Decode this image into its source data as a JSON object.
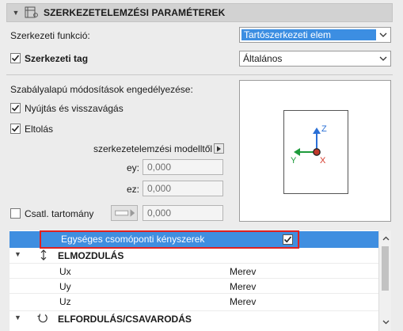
{
  "header": {
    "title": "SZERKEZETELEMZÉSI PARAMÉTEREK"
  },
  "structural_function": {
    "label": "Szerkezeti funkció:",
    "value": "Tartószerkezeti elem"
  },
  "structural_member": {
    "label": "Szerkezeti tag",
    "checked": true,
    "value": "Általános"
  },
  "rule_based": {
    "label": "Szabályalapú módosítások engedélyezése:",
    "extend_trim": {
      "label": "Nyújtás és visszavágás",
      "checked": true
    },
    "offset": {
      "label": "Eltolás",
      "checked": true
    }
  },
  "offset_source": {
    "label": "szerkezetelemzési modelltől"
  },
  "ey": {
    "label": "ey:",
    "value": "0,000"
  },
  "ez": {
    "label": "ez:",
    "value": "0,000"
  },
  "connection_range": {
    "label": "Csatl. tartomány",
    "checked": false,
    "value": "0,000"
  },
  "preview": {
    "axis_z": "Z",
    "axis_y": "Y",
    "axis_x": "X",
    "colors": {
      "z": "#2a6fd6",
      "y": "#1e9b3c",
      "x": "#d63a2a"
    }
  },
  "table": {
    "selected_row": {
      "label": "Egységes csomóponti kényszerek",
      "checked": true
    },
    "group_translation": {
      "label": "ELMOZDULÁS"
    },
    "rows": [
      {
        "name": "Ux",
        "value": "Merev"
      },
      {
        "name": "Uy",
        "value": "Merev"
      },
      {
        "name": "Uz",
        "value": "Merev"
      }
    ],
    "group_rotation": {
      "label": "ELFORDULÁS/CSAVARODÁS"
    }
  },
  "colors": {
    "accent": "#3c8ee2",
    "highlight": "#e02020"
  }
}
